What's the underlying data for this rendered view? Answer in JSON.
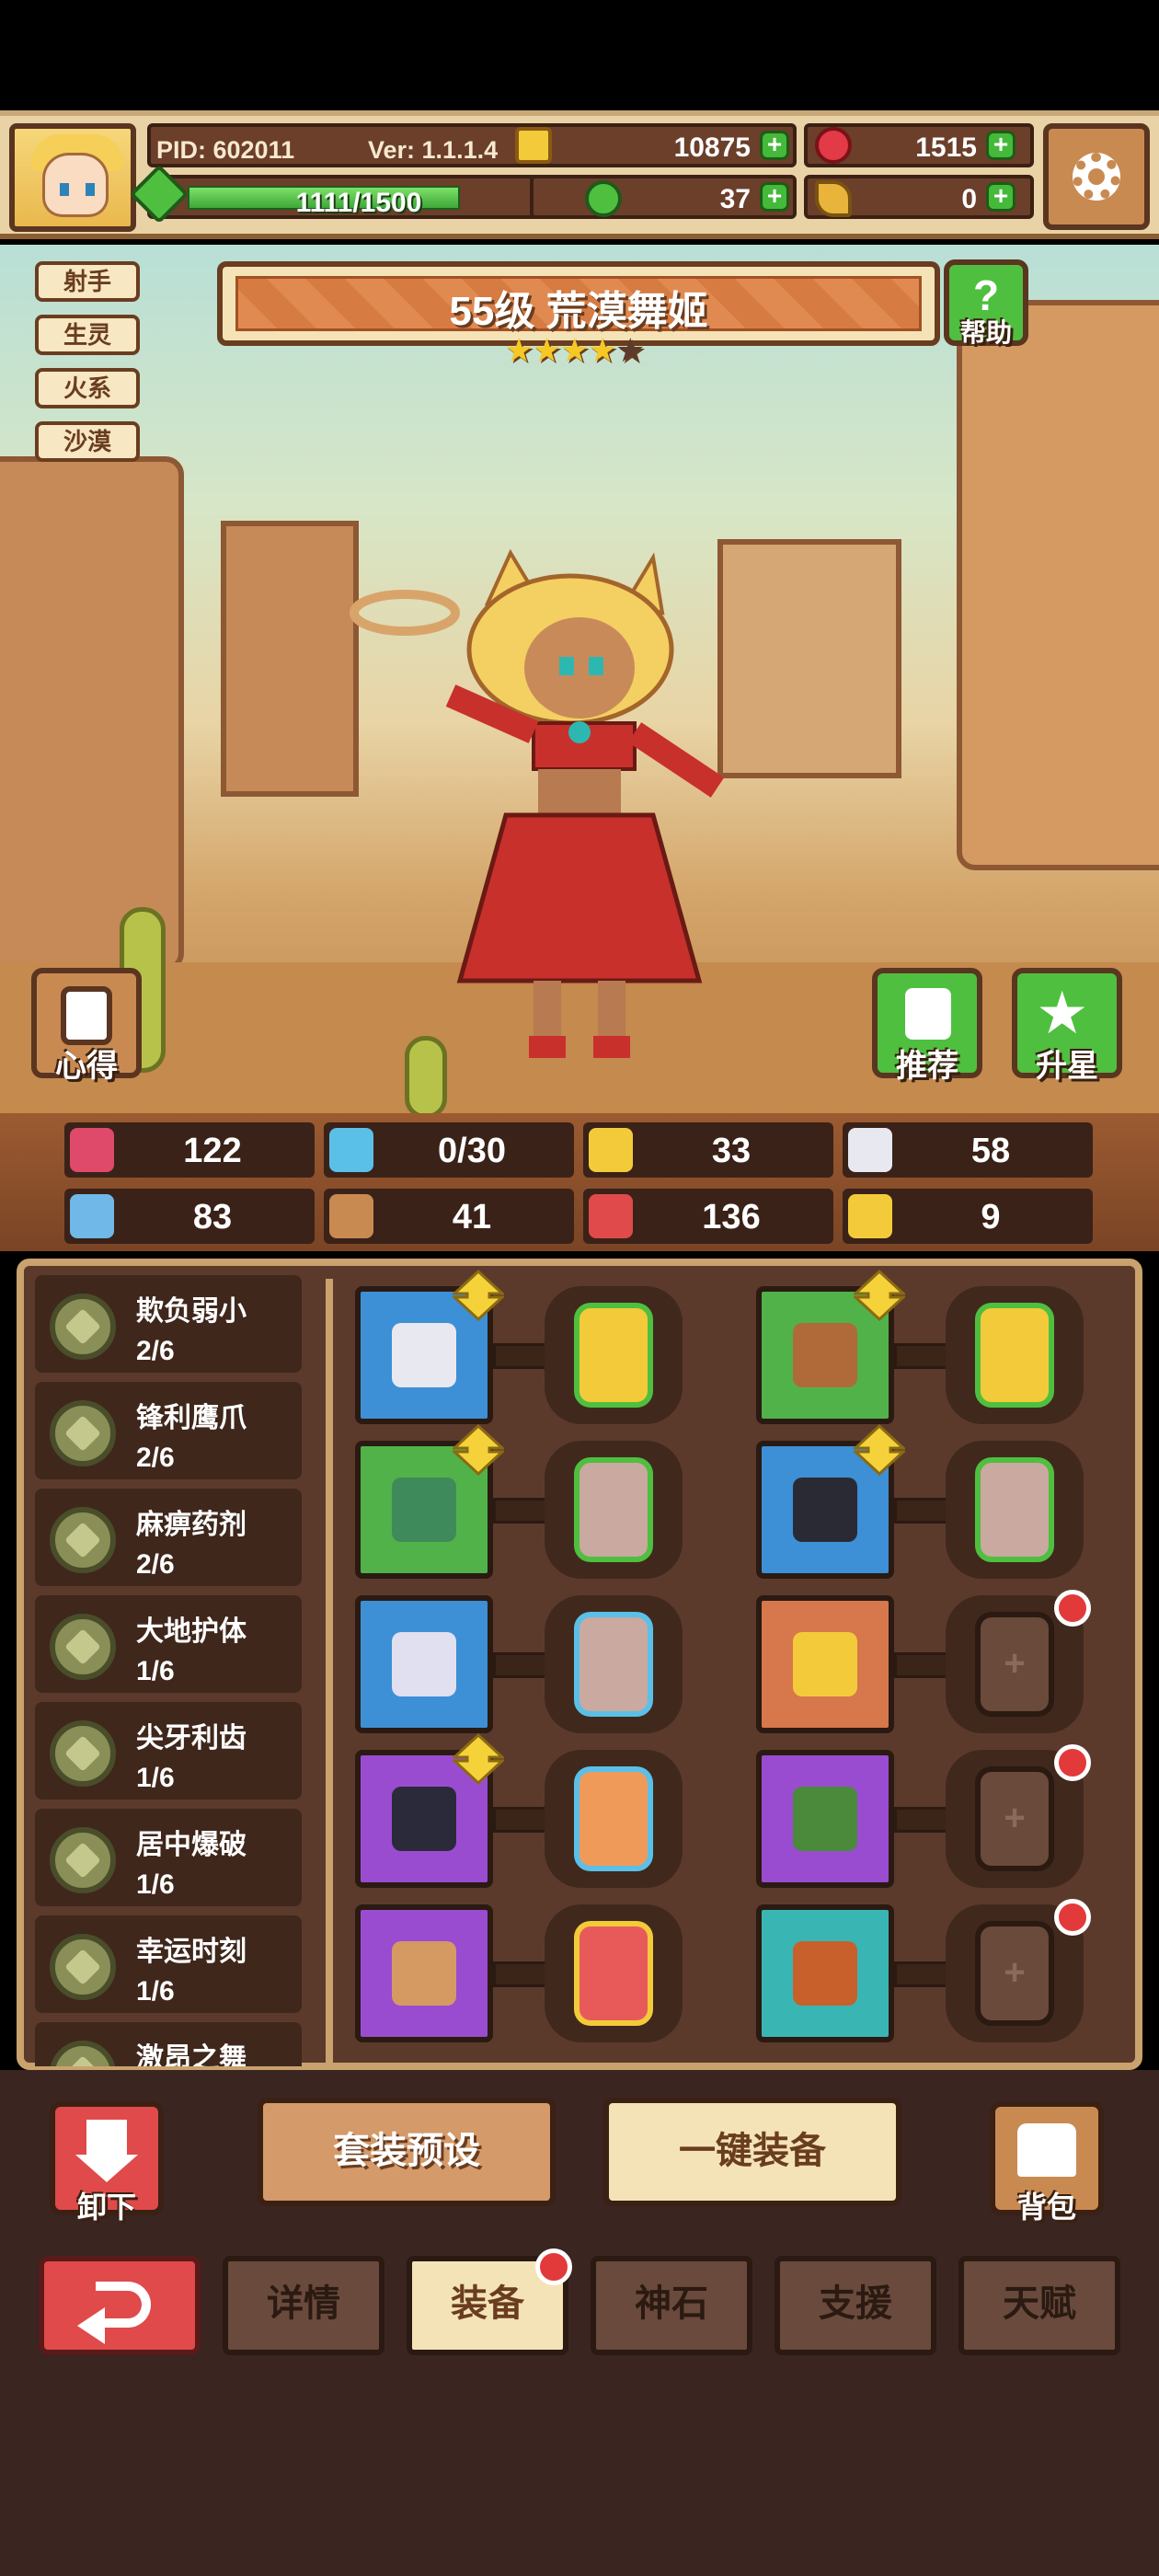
{
  "header": {
    "pid_label": "PID: 602011",
    "version_label": "Ver: 1.1.1.4",
    "exp_text": "1111/1500",
    "exp_fraction": 0.74,
    "gold": "10875",
    "gems": "1515",
    "clover": "37",
    "keys": "0"
  },
  "hero": {
    "tags": [
      "射手",
      "生灵",
      "火系",
      "沙漠"
    ],
    "title": "55级 荒漠舞姬",
    "stars": 4,
    "max_stars": 5,
    "help_label": "帮助",
    "notes_label": "心得",
    "recommend_label": "推荐",
    "star_up_label": "升星"
  },
  "stats": [
    {
      "icon": "heart-icon",
      "value": "122"
    },
    {
      "icon": "water-drop-icon",
      "value": "0/30"
    },
    {
      "icon": "shield-icon",
      "value": "33"
    },
    {
      "icon": "armor-icon",
      "value": "58"
    },
    {
      "icon": "fist-icon",
      "value": "83"
    },
    {
      "icon": "book-icon",
      "value": "41"
    },
    {
      "icon": "speed-boot-icon",
      "value": "136"
    },
    {
      "icon": "magnet-icon",
      "value": "9"
    }
  ],
  "skills": [
    {
      "name": "欺负弱小",
      "level": "2/6"
    },
    {
      "name": "锋利鹰爪",
      "level": "2/6"
    },
    {
      "name": "麻痹药剂",
      "level": "2/6"
    },
    {
      "name": "大地护体",
      "level": "1/6"
    },
    {
      "name": "尖牙利齿",
      "level": "1/6"
    },
    {
      "name": "居中爆破",
      "level": "1/6"
    },
    {
      "name": "幸运时刻",
      "level": "1/6"
    },
    {
      "name": "激昂之舞",
      "level": ""
    }
  ],
  "equipment": {
    "left": [
      {
        "slot": "bow",
        "rarity": "blue",
        "upgrade": true,
        "rune": "gold"
      },
      {
        "slot": "feather",
        "rarity": "green",
        "upgrade": true,
        "rune": "green"
      },
      {
        "slot": "necklace",
        "rarity": "blue",
        "upgrade": false,
        "rune": "blue"
      },
      {
        "slot": "orb",
        "rarity": "purple",
        "upgrade": true,
        "rune": "orange"
      },
      {
        "slot": "crown",
        "rarity": "purple",
        "upgrade": false,
        "rune": "red"
      }
    ],
    "right": [
      {
        "slot": "helmet",
        "rarity": "green",
        "upgrade": true,
        "rune": "gold"
      },
      {
        "slot": "armor",
        "rarity": "blue",
        "upgrade": true,
        "rune": "green"
      },
      {
        "slot": "ring",
        "rarity": "orange",
        "upgrade": false,
        "rune": "empty"
      },
      {
        "slot": "nest",
        "rarity": "purple",
        "upgrade": false,
        "rune": "empty"
      },
      {
        "slot": "boots",
        "rarity": "teal",
        "upgrade": false,
        "rune": "empty"
      }
    ]
  },
  "actions": {
    "unequip_label": "卸下",
    "preset_label": "套装预设",
    "auto_equip_label": "一键装备",
    "bag_label": "背包"
  },
  "tabs": [
    "详情",
    "装备",
    "神石",
    "支援",
    "天赋"
  ],
  "active_tab": 1,
  "colors": {
    "rarity_blue": "#3d8fd6",
    "rarity_green": "#51b24a",
    "rarity_purple": "#9a4cd1",
    "rarity_orange": "#d7774c",
    "rarity_teal": "#39b6b4",
    "upgrade_arrow": "#f6d23a",
    "alert": "#e23a3a"
  }
}
